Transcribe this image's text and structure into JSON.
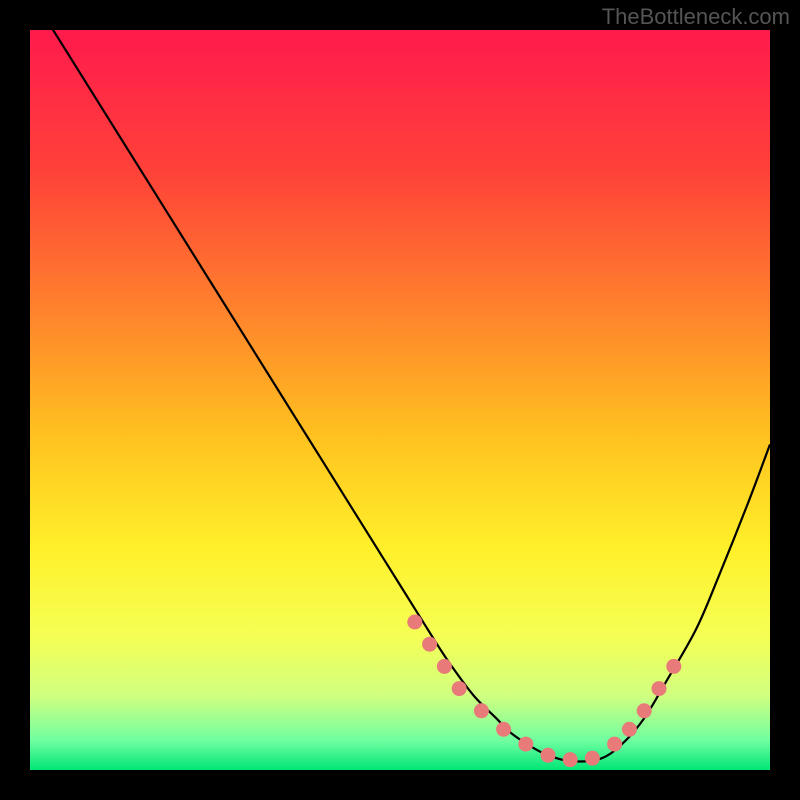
{
  "watermark": "TheBottleneck.com",
  "chart_data": {
    "type": "line",
    "title": "",
    "xlabel": "",
    "ylabel": "",
    "xlim": [
      0,
      100
    ],
    "ylim": [
      0,
      100
    ],
    "grid": false,
    "series": [
      {
        "name": "curve",
        "x": [
          0,
          5,
          10,
          15,
          20,
          25,
          30,
          35,
          40,
          45,
          50,
          55,
          57,
          60,
          63,
          65,
          68,
          70,
          73,
          77,
          80,
          83,
          86,
          90,
          93,
          97,
          100
        ],
        "y": [
          105,
          97,
          89,
          81,
          73,
          65,
          57,
          49,
          41,
          33,
          25,
          17,
          14,
          10,
          7,
          5,
          3,
          2,
          1.2,
          1.5,
          3.5,
          7,
          12,
          19,
          26,
          36,
          44
        ]
      }
    ],
    "markers": {
      "name": "points",
      "x": [
        52,
        54,
        56,
        58,
        61,
        64,
        67,
        70,
        73,
        76,
        79,
        81,
        83,
        85,
        87
      ],
      "y": [
        20,
        17,
        14,
        11,
        8,
        5.5,
        3.5,
        2,
        1.4,
        1.6,
        3.5,
        5.5,
        8,
        11,
        14
      ]
    },
    "background_gradient": {
      "stops": [
        {
          "offset": 0,
          "color": "#ff1a4d"
        },
        {
          "offset": 0.2,
          "color": "#ff4438"
        },
        {
          "offset": 0.4,
          "color": "#ff8a2b"
        },
        {
          "offset": 0.55,
          "color": "#ffc21f"
        },
        {
          "offset": 0.7,
          "color": "#fff02a"
        },
        {
          "offset": 0.82,
          "color": "#f5ff55"
        },
        {
          "offset": 0.9,
          "color": "#d0ff80"
        },
        {
          "offset": 0.96,
          "color": "#70ffa0"
        },
        {
          "offset": 1,
          "color": "#00e676"
        }
      ]
    },
    "marker_color": "#e87a7a",
    "line_color": "#000000"
  }
}
